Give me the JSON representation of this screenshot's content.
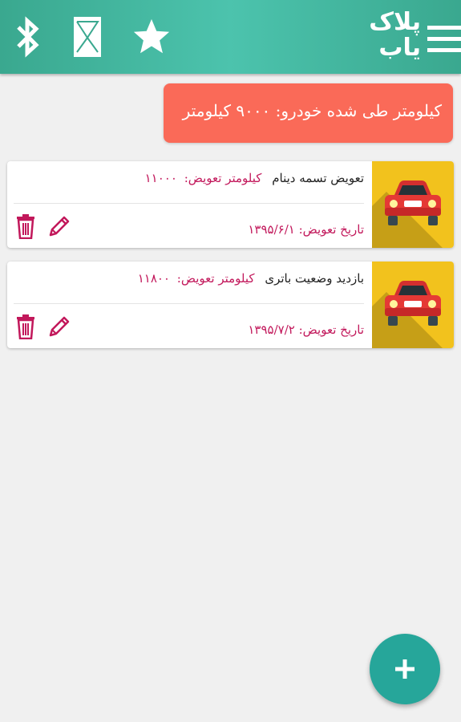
{
  "app": {
    "logo_line1": "پلاک",
    "logo_line2": "یاب",
    "icons": [
      "menu-icon",
      "bluetooth-icon",
      "sms-icon",
      "star-icon"
    ]
  },
  "banner": {
    "text": "کیلومتر طی شده خودرو: ۹۰۰۰ کیلومتر"
  },
  "records": [
    {
      "title": "تعویض تسمه دینام",
      "km_label": "کیلومتر تعویض:",
      "km_value": "۱۱۰۰۰",
      "date_label": "تاریخ تعویض:",
      "date_value": "۱۳۹۵/۶/۱",
      "icon": "car-icon"
    },
    {
      "title": "بازدید وضعیت باتری",
      "km_label": "کیلومتر تعویض:",
      "km_value": "۱۱۸۰۰",
      "date_label": "تاریخ تعویض:",
      "date_value": "۱۳۹۵/۷/۲",
      "icon": "car-icon"
    }
  ],
  "fab": {
    "label": "+",
    "icon": "add-icon"
  },
  "colors": {
    "primary": "#3aa88f",
    "banner": "#fa6a58",
    "accent": "#c2185b",
    "thumb": "#f2c21d",
    "fab": "#26a69a"
  }
}
